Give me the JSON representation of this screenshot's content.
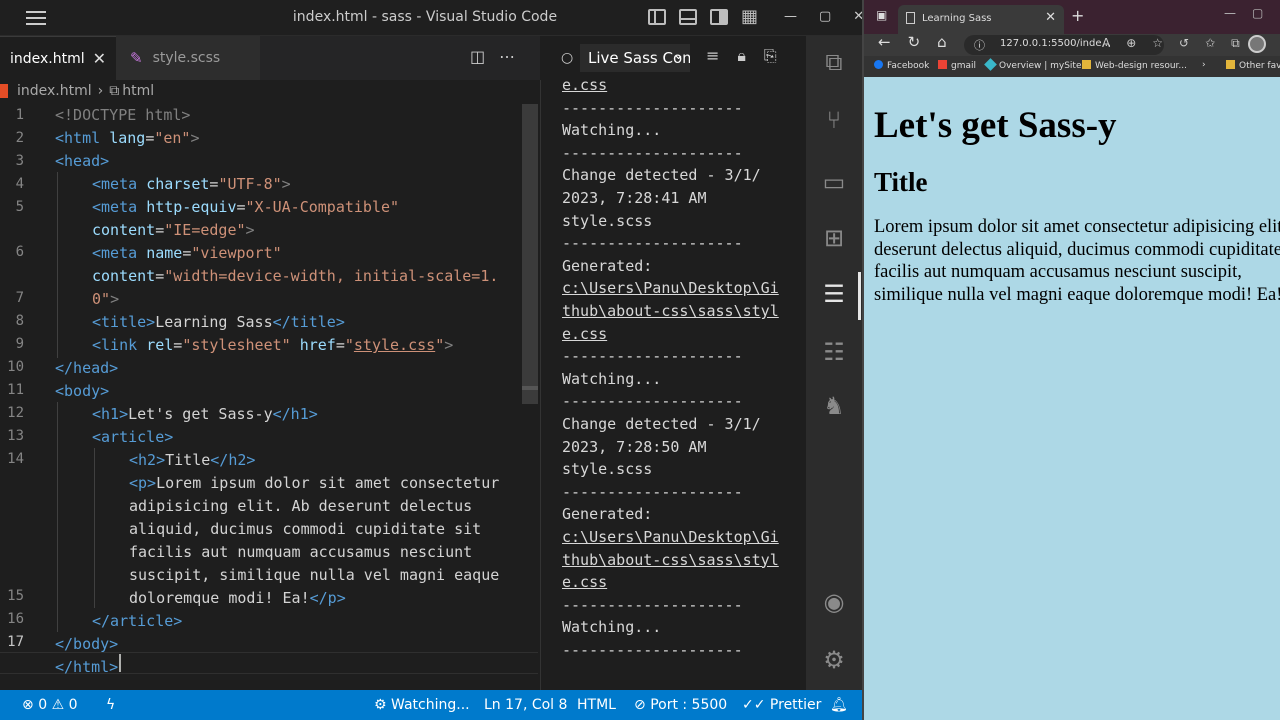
{
  "vscode": {
    "window_title": "index.html - sass - Visual Studio Code",
    "tabs": [
      {
        "label": "index.html",
        "close": "✕"
      },
      {
        "label": "style.scss"
      }
    ],
    "breadcrumb": {
      "file": "index.html",
      "symbol": "html"
    },
    "line_numbers": [
      "1",
      "2",
      "3",
      "4",
      "5",
      "",
      "6",
      "",
      "7",
      "8",
      "9",
      "10",
      "11",
      "12",
      "13",
      "14",
      "",
      "",
      "",
      "",
      "",
      "15",
      "16",
      "17"
    ],
    "code": {
      "l1": "<!DOCTYPE html>",
      "l2a": "<html ",
      "l2b": "lang",
      "l2c": "=",
      "l2d": "\"en\"",
      "l2e": ">",
      "l3": "<head>",
      "l4a": "<meta ",
      "l4b": "charset",
      "l4c": "=",
      "l4d": "\"UTF-8\"",
      "l4e": ">",
      "l5a": "<meta ",
      "l5b": "http-equiv",
      "l5c": "=",
      "l5d": "\"X-UA-Compatible\"",
      "l5f": "content",
      "l5g": "=",
      "l5h": "\"IE=edge\"",
      "l5i": ">",
      "l6a": "<meta ",
      "l6b": "name",
      "l6c": "=",
      "l6d": "\"viewport\"",
      "l6f": "content",
      "l6g": "=",
      "l6h": "\"width=device-width, initial-scale=1.",
      "l6i": "0\"",
      "l6j": ">",
      "l7a": "<title>",
      "l7b": "Learning Sass",
      "l7c": "</title>",
      "l8a": "<link ",
      "l8b": "rel",
      "l8c": "=",
      "l8d": "\"stylesheet\"",
      "l8e": " href",
      "l8f": "=",
      "l8g": "\"",
      "l8h": "style.css",
      "l8i": "\"",
      "l8j": ">",
      "l9": "</head>",
      "l10": "<body>",
      "l11a": "<h1>",
      "l11b": "Let's get Sass-y",
      "l11c": "</h1>",
      "l12": "<article>",
      "l13a": "<h2>",
      "l13b": "Title",
      "l13c": "</h2>",
      "l14a": "<p>",
      "l14b": "Lorem ipsum dolor sit amet consectetur",
      "l14c": "adipisicing elit. Ab deserunt delectus",
      "l14d": "aliquid, ducimus commodi cupiditate sit",
      "l14e": "facilis aut numquam accusamus nesciunt",
      "l14f": "suscipit, similique nulla vel magni eaque",
      "l14g": "doloremque modi! Ea!",
      "l14h": "</p>",
      "l15": "</article>",
      "l16": "</body>",
      "l17": "</html>"
    },
    "output_panel": {
      "selected": "Live Sass Compiler",
      "lines": [
        "e.css",
        "--------------------",
        "Watching...",
        "--------------------",
        "Change detected - 3/1/",
        "2023, 7:28:41 AM",
        "style.scss",
        "--------------------",
        "Generated:",
        "c:\\Users\\Panu\\Desktop\\Gi",
        "thub\\about-css\\sass\\styl",
        "e.css",
        "--------------------",
        "Watching...",
        "--------------------",
        "Change detected - 3/1/",
        "2023, 7:28:50 AM",
        "style.scss",
        "--------------------",
        "Generated:",
        "c:\\Users\\Panu\\Desktop\\Gi",
        "thub\\about-css\\sass\\styl",
        "e.css",
        "--------------------",
        "Watching...",
        "--------------------"
      ]
    },
    "status": {
      "errors": "0",
      "warnings": "0",
      "watching": "Watching...",
      "position": "Ln 17, Col 8",
      "language": "HTML",
      "port": "Port : 5500",
      "prettier": "Prettier"
    }
  },
  "browser": {
    "tab_title": "Learning Sass",
    "url": "127.0.0.1:5500/inde...",
    "bookmarks": [
      "Facebook",
      "gmail",
      "Overview | mySite",
      "Web-design resour...",
      "Other favo"
    ],
    "page": {
      "h1": "Let's get Sass-y",
      "h2": "Title",
      "p": "Lorem ipsum dolor sit amet consectetur adipisicing elit. Ab deserunt delectus aliquid, ducimus commodi cupiditate sit facilis aut numquam accusamus nesciunt suscipit, similique nulla vel magni eaque doloremque modi! Ea!"
    }
  },
  "colors": {
    "statusbar": "#007acc",
    "page_background": "#add8e6",
    "tag": "#569cd6",
    "attribute": "#9cdcfe",
    "string": "#ce9178"
  }
}
